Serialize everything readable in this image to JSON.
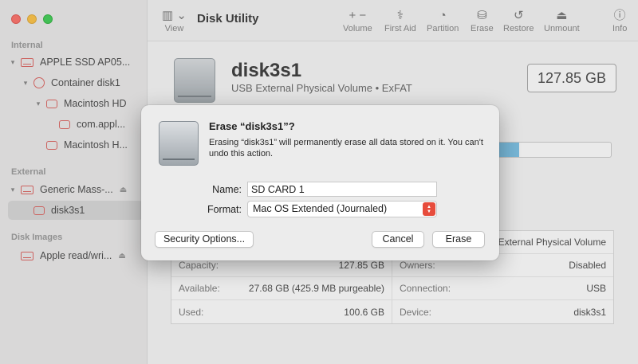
{
  "sidebar": {
    "sections": [
      {
        "label": "Internal"
      },
      {
        "label": "External"
      },
      {
        "label": "Disk Images"
      }
    ],
    "items": [
      {
        "label": "APPLE SSD AP05..."
      },
      {
        "label": "Container disk1"
      },
      {
        "label": "Macintosh HD"
      },
      {
        "label": "com.appl..."
      },
      {
        "label": "Macintosh H..."
      },
      {
        "label": "Generic Mass-..."
      },
      {
        "label": "disk3s1"
      },
      {
        "label": "Apple read/wri..."
      }
    ],
    "eject_glyph": "⏏"
  },
  "toolbar": {
    "view_label": "View",
    "title": "Disk Utility",
    "volume_label": "Volume",
    "first_aid_label": "First Aid",
    "partition_label": "Partition",
    "erase_label": "Erase",
    "restore_label": "Restore",
    "unmount_label": "Unmount",
    "info_label": "Info"
  },
  "main": {
    "disk_name": "disk3s1",
    "disk_desc": "USB External Physical Volume • ExFAT",
    "capacity_display": "127.85 GB",
    "usage_fraction_start": 0.72,
    "usage_fraction_end": 0.79,
    "usage_color": "#6bbbe4",
    "info": [
      {
        "k1": "",
        "v1": "",
        "k2": "",
        "v2": "SB External Physical Volume"
      },
      {
        "k1": "Capacity:",
        "v1": "127.85 GB",
        "k2": "Owners:",
        "v2": "Disabled"
      },
      {
        "k1": "Available:",
        "v1": "27.68 GB (425.9 MB purgeable)",
        "k2": "Connection:",
        "v2": "USB"
      },
      {
        "k1": "Used:",
        "v1": "100.6 GB",
        "k2": "Device:",
        "v2": "disk3s1"
      }
    ]
  },
  "dialog": {
    "title": "Erase “disk3s1”?",
    "message": "Erasing “disk3s1” will permanently erase all data stored on it. You can't undo this action.",
    "name_label": "Name:",
    "name_value": "SD CARD 1",
    "format_label": "Format:",
    "format_value": "Mac OS Extended (Journaled)",
    "security_button": "Security Options...",
    "cancel_button": "Cancel",
    "erase_button": "Erase",
    "accent": "#e74c3c"
  }
}
